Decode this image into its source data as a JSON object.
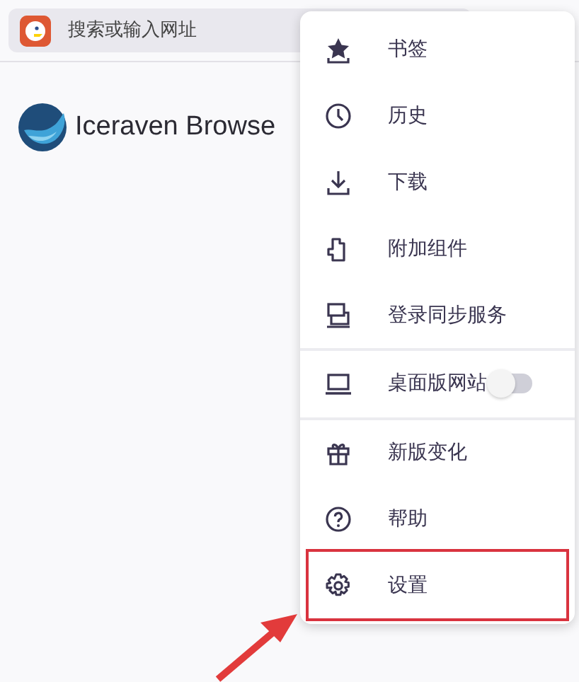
{
  "address_bar": {
    "placeholder": "搜索或输入网址"
  },
  "logo": {
    "text": "Iceraven Browse"
  },
  "menu": {
    "items": [
      {
        "kind": "item",
        "label": "书签",
        "divider_before": false,
        "highlighted": false
      },
      {
        "kind": "item",
        "label": "历史",
        "divider_before": false,
        "highlighted": false
      },
      {
        "kind": "item",
        "label": "下载",
        "divider_before": false,
        "highlighted": false
      },
      {
        "kind": "item",
        "label": "附加组件",
        "divider_before": false,
        "highlighted": false
      },
      {
        "kind": "item",
        "label": "登录同步服务",
        "divider_before": false,
        "highlighted": false
      },
      {
        "kind": "toggle",
        "label": "桌面版网站",
        "divider_before": true,
        "highlighted": false,
        "on": false
      },
      {
        "kind": "item",
        "label": "新版变化",
        "divider_before": true,
        "highlighted": false
      },
      {
        "kind": "item",
        "label": "帮助",
        "divider_before": false,
        "highlighted": false
      },
      {
        "kind": "item",
        "label": "设置",
        "divider_before": false,
        "highlighted": true
      }
    ]
  }
}
